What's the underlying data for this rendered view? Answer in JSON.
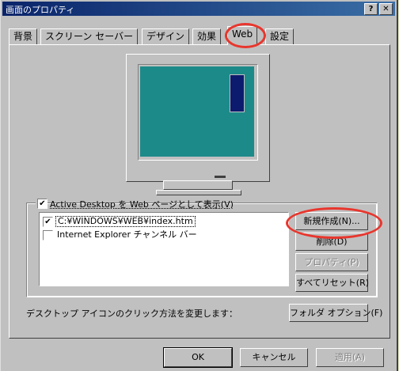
{
  "window": {
    "title": "画面のプロパティ",
    "help_button": "?",
    "close_button": "✕"
  },
  "tabs": [
    {
      "label": "背景"
    },
    {
      "label": "スクリーン セーバー"
    },
    {
      "label": "デザイン"
    },
    {
      "label": "効果"
    },
    {
      "label": "Web"
    },
    {
      "label": "設定"
    }
  ],
  "active_tab": "Web",
  "active_desktop": {
    "label": "Active Desktop を Web ページとして表示(V)",
    "checked_mark": "✔"
  },
  "list_items": [
    {
      "label": "C:¥WINDOWS¥WEB¥index.htm",
      "checked_mark": "✔"
    },
    {
      "label": "Internet Explorer チャンネル バー",
      "checked_mark": ""
    }
  ],
  "buttons": {
    "new": "新規作成(N)...",
    "delete": "削除(D)",
    "properties": "プロパティ(P)",
    "reset": "すべてリセット(R)",
    "folder_options": "フォルダ オプション(F)"
  },
  "hint_text": "デスクトップ アイコンのクリック方法を変更します：",
  "footer": {
    "ok": "OK",
    "cancel": "キャンセル",
    "apply": "適用(A)"
  },
  "colors": {
    "desktop_teal": "#1d8a8a",
    "highlight_oval": "#e8362d"
  }
}
